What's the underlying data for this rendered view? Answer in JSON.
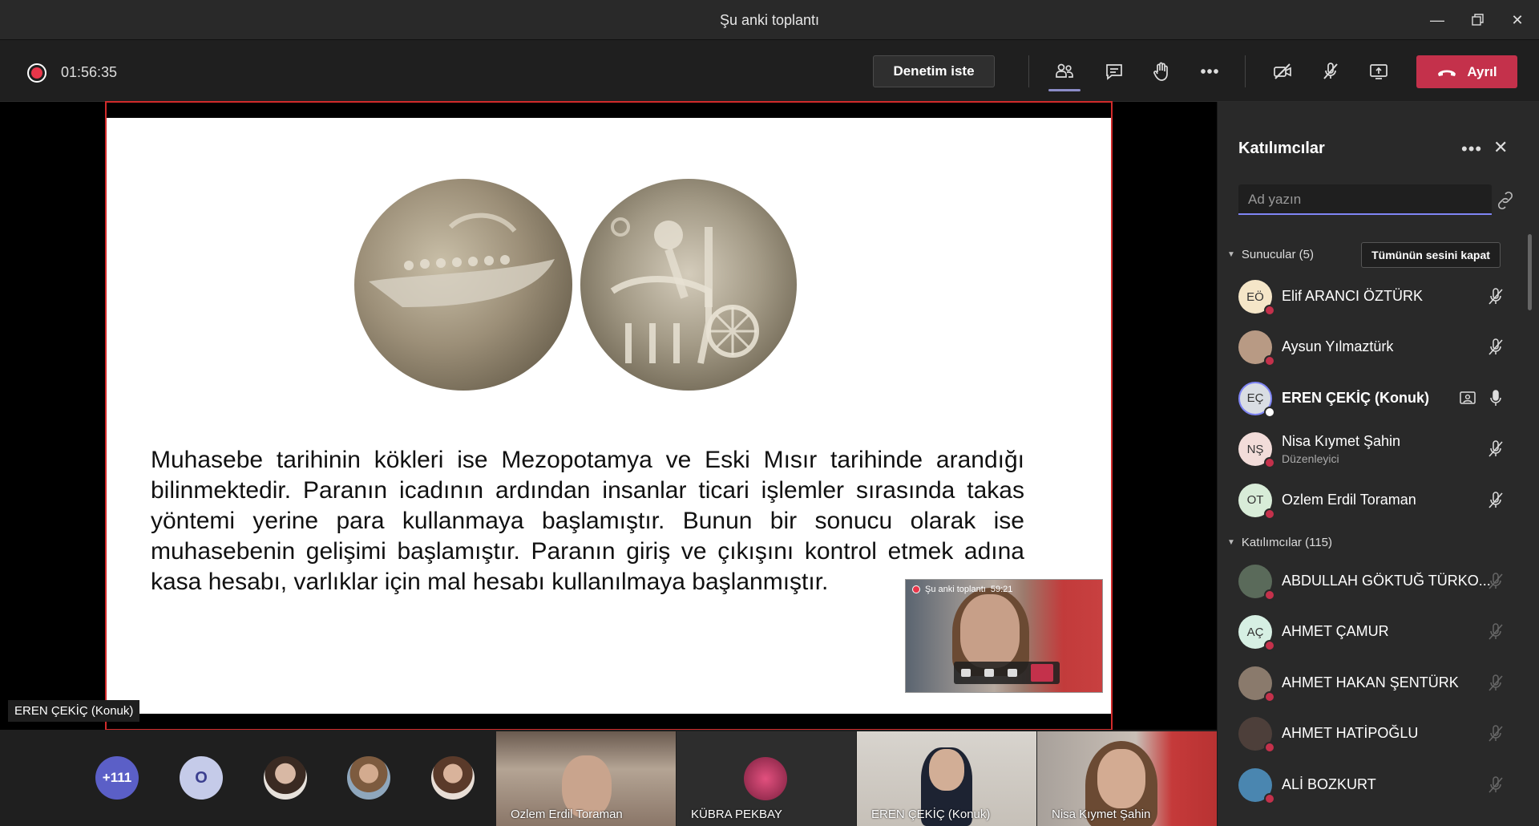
{
  "window": {
    "title": "Şu anki toplantı"
  },
  "toolbar": {
    "timer": "01:56:35",
    "control_button": "Denetim iste",
    "leave_button": "Ayrıl"
  },
  "slide": {
    "text_lines": [
      "Muhasebe tarihinin kökleri ise Mezopotamya ve Eski Mısır tarihinde arandığı",
      "bilinmektedir. Paranın icadının ardından insanlar ticari işlemler sırasında takas",
      "yöntemi yerine para kullanmaya başlamıştır. Bunun bir sonucu olarak ise",
      "muhasebenin gelişimi başlamıştır. Paranın giriş ve çıkışını kontrol etmek adına",
      "kasa hesabı, varlıklar için mal hesabı kullanılmaya başlanmıştır."
    ],
    "mini_window_title": "Şu anki toplantı",
    "mini_window_time": "59:21"
  },
  "speaker_tag": "EREN ÇEKİÇ (Konuk)",
  "bottom_strip": {
    "overflow_count": "+111",
    "initial_avatar": "O",
    "tiles": [
      {
        "name": "Ozlem Erdil Toraman"
      },
      {
        "name": "KÜBRA PEKBAY"
      },
      {
        "name": "EREN ÇEKİÇ (Konuk)"
      },
      {
        "name": "Nisa Kıymet Şahin"
      }
    ]
  },
  "panel": {
    "title": "Katılımcılar",
    "search_placeholder": "Ad yazın",
    "presenters_header": "Sunucular (5)",
    "mute_all": "Tümünün sesini kapat",
    "attendees_header": "Katılımcılar (115)",
    "presenters": [
      {
        "initials": "EÖ",
        "name": "Elif ARANCI ÖZTÜRK",
        "role": "",
        "avatar_color": "#f5e6c8"
      },
      {
        "initials": "",
        "name": "Aysun Yılmaztürk",
        "role": "",
        "avatar_color": "#b89a84"
      },
      {
        "initials": "EÇ",
        "name": "EREN ÇEKİÇ (Konuk)",
        "role": "",
        "avatar_color": "#d9dde3"
      },
      {
        "initials": "NŞ",
        "name": "Nisa Kıymet Şahin",
        "role": "Düzenleyici",
        "avatar_color": "#f2dcd9"
      },
      {
        "initials": "OT",
        "name": "Ozlem Erdil Toraman",
        "role": "",
        "avatar_color": "#d8ecd8"
      }
    ],
    "attendees": [
      {
        "initials": "",
        "name": "ABDULLAH GÖKTUĞ TÜRKO...",
        "avatar_color": "#5a6a5a"
      },
      {
        "initials": "AÇ",
        "name": "AHMET ÇAMUR",
        "avatar_color": "#d6efe3"
      },
      {
        "initials": "",
        "name": "AHMET HAKAN ŞENTÜRK",
        "avatar_color": "#8a7a6c"
      },
      {
        "initials": "",
        "name": "AHMET HATİPOĞLU",
        "avatar_color": "#4d3f3a"
      },
      {
        "initials": "",
        "name": "ALİ BOZKURT",
        "avatar_color": "#4a86b0"
      }
    ]
  }
}
